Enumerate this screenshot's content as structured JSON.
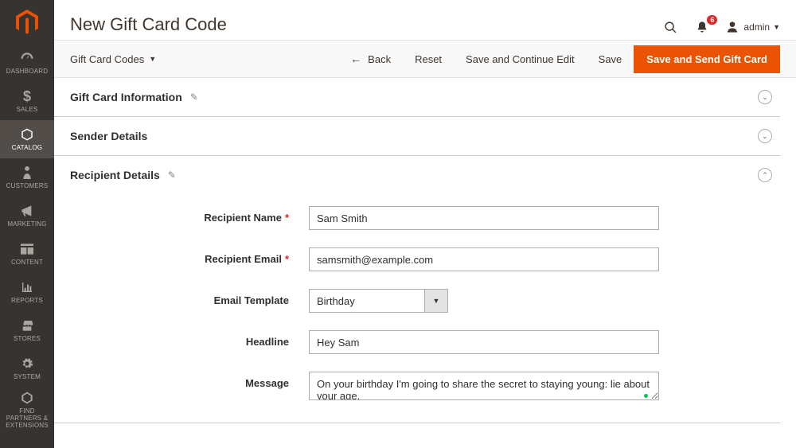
{
  "header": {
    "page_title": "New Gift Card Code",
    "notification_count": "6",
    "admin_label": "admin"
  },
  "sidebar": {
    "items": [
      {
        "label": "DASHBOARD"
      },
      {
        "label": "SALES"
      },
      {
        "label": "CATALOG"
      },
      {
        "label": "CUSTOMERS"
      },
      {
        "label": "MARKETING"
      },
      {
        "label": "CONTENT"
      },
      {
        "label": "REPORTS"
      },
      {
        "label": "STORES"
      },
      {
        "label": "SYSTEM"
      },
      {
        "label": "FIND PARTNERS & EXTENSIONS"
      }
    ]
  },
  "action_bar": {
    "store_switch_label": "Gift Card Codes",
    "back_label": "Back",
    "reset_label": "Reset",
    "save_continue_label": "Save and Continue Edit",
    "save_label": "Save",
    "save_send_label": "Save and Send Gift Card"
  },
  "sections": {
    "gift_card_info_title": "Gift Card Information",
    "sender_details_title": "Sender Details",
    "recipient_details_title": "Recipient Details"
  },
  "form": {
    "recipient_name": {
      "label": "Recipient Name",
      "value": "Sam Smith"
    },
    "recipient_email": {
      "label": "Recipient Email",
      "value": "samsmith@example.com"
    },
    "email_template": {
      "label": "Email Template",
      "value": "Birthday"
    },
    "headline": {
      "label": "Headline",
      "value": "Hey Sam"
    },
    "message": {
      "label": "Message",
      "value": "On your birthday I'm going to share the secret to staying young: lie about your age."
    }
  }
}
